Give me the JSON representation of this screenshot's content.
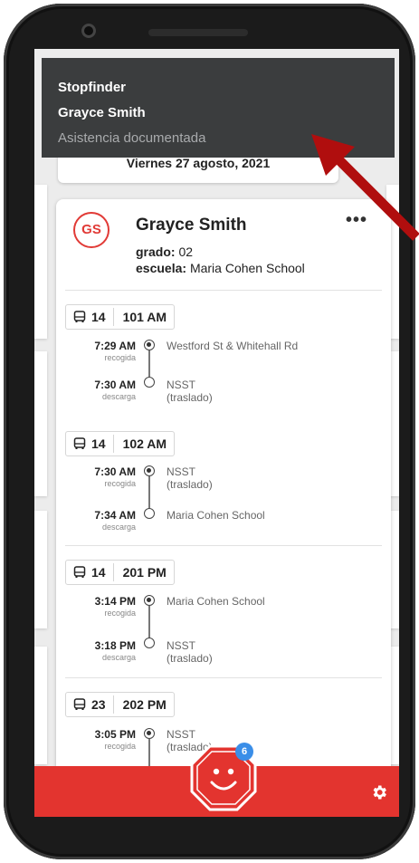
{
  "notification": {
    "app": "Stopfinder",
    "student": "Grayce Smith",
    "message": "Asistencia documentada"
  },
  "date_header": "Viernes 27 agosto, 2021",
  "student_card": {
    "initials": "GS",
    "name": "Grayce Smith",
    "more": "•••",
    "grade_label": "grado:",
    "grade_value": "02",
    "school_label": "escuela:",
    "school_value": "Maria Cohen School"
  },
  "trips": [
    {
      "bus_number": "14",
      "route_name": "101 AM",
      "stops": [
        {
          "time": "7:29 AM",
          "type": "recogida",
          "place": "Westford St & Whitehall Rd",
          "place2": ""
        },
        {
          "time": "7:30 AM",
          "type": "descarga",
          "place": "NSST",
          "place2": "(traslado)"
        }
      ]
    },
    {
      "bus_number": "14",
      "route_name": "102 AM",
      "stops": [
        {
          "time": "7:30 AM",
          "type": "recogida",
          "place": "NSST",
          "place2": "(traslado)"
        },
        {
          "time": "7:34 AM",
          "type": "descarga",
          "place": "Maria Cohen School",
          "place2": ""
        }
      ]
    },
    {
      "bus_number": "14",
      "route_name": "201 PM",
      "stops": [
        {
          "time": "3:14 PM",
          "type": "recogida",
          "place": "Maria Cohen School",
          "place2": ""
        },
        {
          "time": "3:18 PM",
          "type": "descarga",
          "place": "NSST",
          "place2": "(traslado)"
        }
      ]
    },
    {
      "bus_number": "23",
      "route_name": "202 PM",
      "stops": [
        {
          "time": "3:05 PM",
          "type": "recogida",
          "place": "NSST",
          "place2": "(traslado)"
        }
      ]
    }
  ],
  "bottom_bar": {
    "badge_count": "6",
    "accent_color": "#e3342f",
    "badge_color": "#3a8ee8"
  },
  "icons": [
    "bus-icon",
    "settings-gear-icon",
    "stop-sign-smiley-icon",
    "more-options-icon"
  ]
}
